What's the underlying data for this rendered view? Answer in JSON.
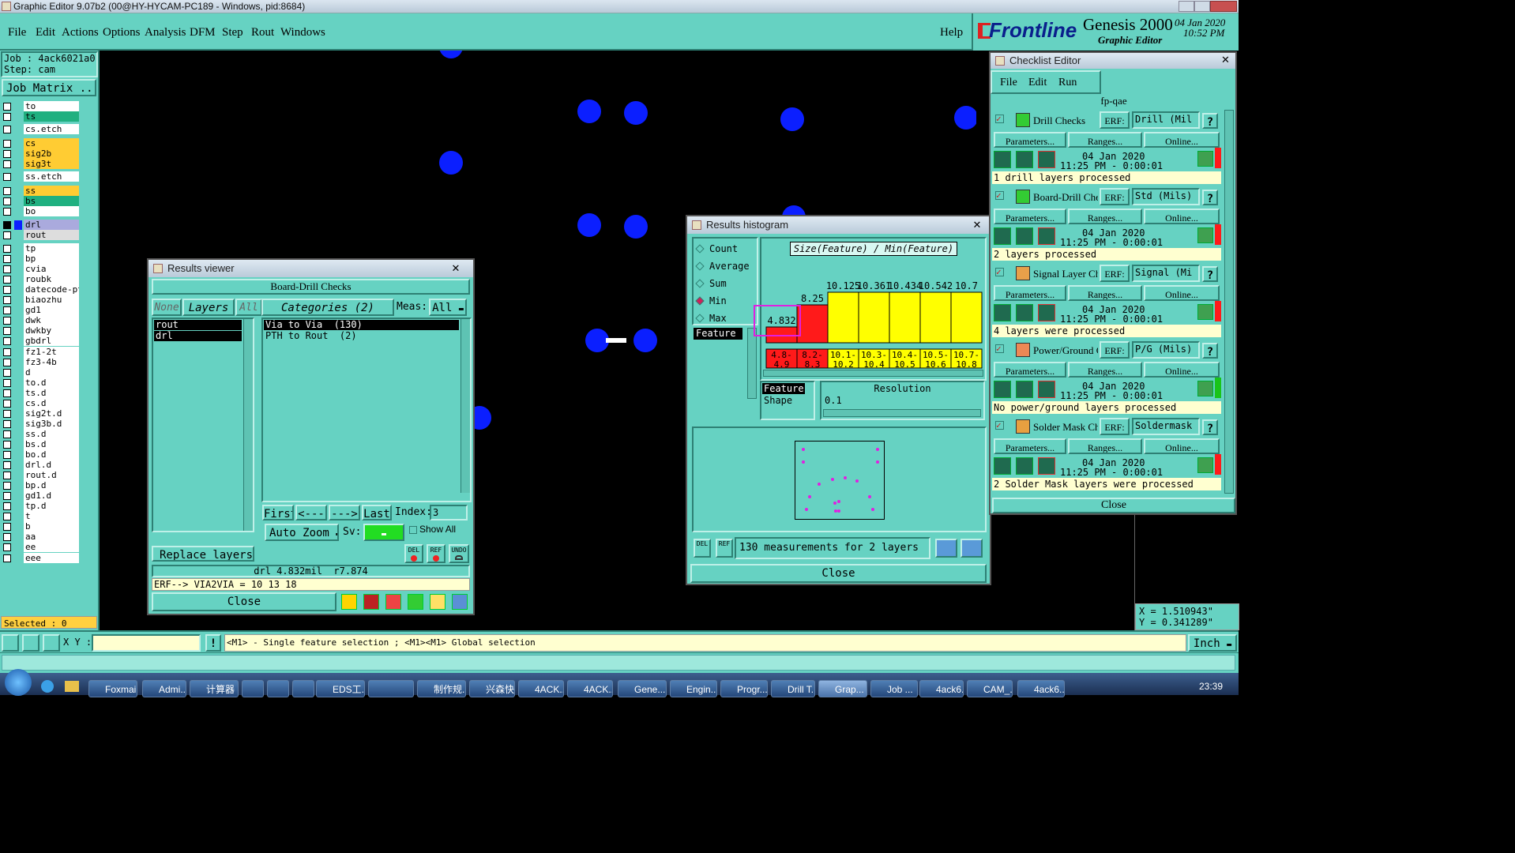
{
  "window_title": "Graphic Editor 9.07b2 (00@HY-HYCAM-PC189 - Windows, pid:8684)",
  "menu": [
    "File",
    "Edit",
    "Actions",
    "Options",
    "Analysis",
    "DFM",
    "Step",
    "Rout",
    "Windows"
  ],
  "help_label": "Help",
  "brand": {
    "logo": "Frontline",
    "product": "Genesis 2000",
    "subtitle": "Graphic Editor",
    "date": "04 Jan 2020",
    "time": "10:52 PM"
  },
  "job": {
    "job_label": "Job : 4ack6021a0",
    "step_label": "Step: cam",
    "job_matrix": "Job Matrix ..."
  },
  "layers": [
    "to",
    "ts",
    "cs.etch",
    "cs",
    "sig2b",
    "sig3t",
    "ss.etch",
    "ss",
    "bs",
    "bo",
    "drl",
    "rout",
    "tp",
    "bp",
    "cvia",
    "roubk",
    "datecode-pt",
    "biaozhu",
    "gd1",
    "dwk",
    "dwkby",
    "gbdrl",
    "fz1-2t",
    "fz3-4b",
    "d",
    "to.d",
    "ts.d",
    "cs.d",
    "sig2t.d",
    "sig3b.d",
    "ss.d",
    "bs.d",
    "bo.d",
    "drl.d",
    "rout.d",
    "bp.d",
    "gd1.d",
    "tp.d",
    "t",
    "b",
    "aa",
    "ee",
    "eee"
  ],
  "selected_label": "Selected : 0",
  "bottom": {
    "xy_label": "X Y :",
    "xy_value": "",
    "status": "<M1> - Single feature selection ; <M1><M1> Global selection",
    "unit": "Inch"
  },
  "coords": {
    "x": "X = 1.510943\"",
    "y": "Y = 0.341289\""
  },
  "results_viewer": {
    "title": "Results viewer",
    "header": "Board-Drill Checks",
    "none": "None",
    "layers": "Layers",
    "all": "All",
    "layer_items": [
      "rout",
      "drl"
    ],
    "categories": "Categories (2)",
    "meas_label": "Meas:",
    "meas_value": "All",
    "category_items": [
      "Via to Via  (130)",
      "PTH to Rout  (2)"
    ],
    "first": "First",
    "prev": "<---",
    "next": "--->",
    "last": "Last",
    "index_label": "Index:",
    "index_value": "3",
    "auto_zoom": "Auto Zoom",
    "sv_label": "Sv:",
    "show_all": "Show All",
    "replace_layers": "Replace layers",
    "del": "DEL",
    "ref": "REF",
    "undo": "UNDO",
    "info": "drl 4.832mil  r7.874",
    "erf": "ERF--> VIA2VIA = 10 13 18",
    "close": "Close"
  },
  "histogram": {
    "title": "Results histogram",
    "modes": [
      "Count",
      "Average",
      "Sum",
      "Min",
      "Max"
    ],
    "selected_mode": "Min",
    "feature_tab": "Feature",
    "chart_title": "Size(Feature) / Min(Feature)",
    "bar_values": [
      "4.832",
      "8.25",
      "10.125",
      "10.361",
      "10.434",
      "10.542",
      "10.7"
    ],
    "bin_labels": [
      [
        "4.8-",
        "4.9"
      ],
      [
        "8.2-",
        "8.3"
      ],
      [
        "10.1-",
        "10.2"
      ],
      [
        "10.3-",
        "10.4"
      ],
      [
        "10.4-",
        "10.5"
      ],
      [
        "10.5-",
        "10.6"
      ],
      [
        "10.7-",
        "10.8"
      ]
    ],
    "bar_colors": [
      "#ff1a1a",
      "#ff1a1a",
      "#ffff00",
      "#ffff00",
      "#ffff00",
      "#ffff00",
      "#ffff00"
    ],
    "feature_list": [
      "Feature",
      "Shape"
    ],
    "resolution_label": "Resolution",
    "resolution_value": "0.1",
    "summary": "130 measurements for 2 layers",
    "del": "DEL",
    "ref": "REF",
    "close": "Close"
  },
  "checklist": {
    "title": "Checklist Editor",
    "menu": [
      "File",
      "Edit",
      "Run"
    ],
    "name": "fp-qae",
    "erf_label": "ERF:",
    "params": "Parameters...",
    "ranges": "Ranges...",
    "online": "Online...",
    "items": [
      {
        "name": "Drill Checks",
        "erf": "Drill (Mil",
        "date": "04 Jan 2020",
        "time": "11:25 PM - 0:00:01",
        "status": "1 drill layers processed",
        "flag": "#ff1a1a"
      },
      {
        "name": "Board-Drill Che",
        "erf": "Std (Mils)",
        "date": "04 Jan 2020",
        "time": "11:25 PM - 0:00:01",
        "status": "2 layers processed",
        "flag": "#ff1a1a"
      },
      {
        "name": "Signal Layer Ch",
        "erf": "Signal (Mi",
        "date": "04 Jan 2020",
        "time": "11:25 PM - 0:00:01",
        "status": "4 layers were processed",
        "flag": "#ff1a1a"
      },
      {
        "name": "Power/Ground C",
        "erf": "P/G (Mils)",
        "date": "04 Jan 2020",
        "time": "11:25 PM - 0:00:01",
        "status": "No power/ground layers processed",
        "flag": "#19c419"
      },
      {
        "name": "Solder Mask Ch",
        "erf": "Soldermask",
        "date": "04 Jan 2020",
        "time": "11:25 PM - 0:00:01",
        "status": "2 Solder Mask layers were processed",
        "flag": "#ff1a1a"
      }
    ],
    "close": "Close"
  },
  "taskbar": {
    "items": [
      "Foxmail",
      "Admi...",
      "计算器",
      "",
      "",
      "",
      "EDS工...",
      "",
      "制作规...",
      "兴森快...",
      "4ACK...",
      "4ACK...",
      "Gene...",
      "Engin...",
      "Progr...",
      "Drill T...",
      "Grap...",
      "Job ...",
      "4ack6...",
      "CAM_...",
      "4ack6..."
    ],
    "clock": "23:39"
  }
}
